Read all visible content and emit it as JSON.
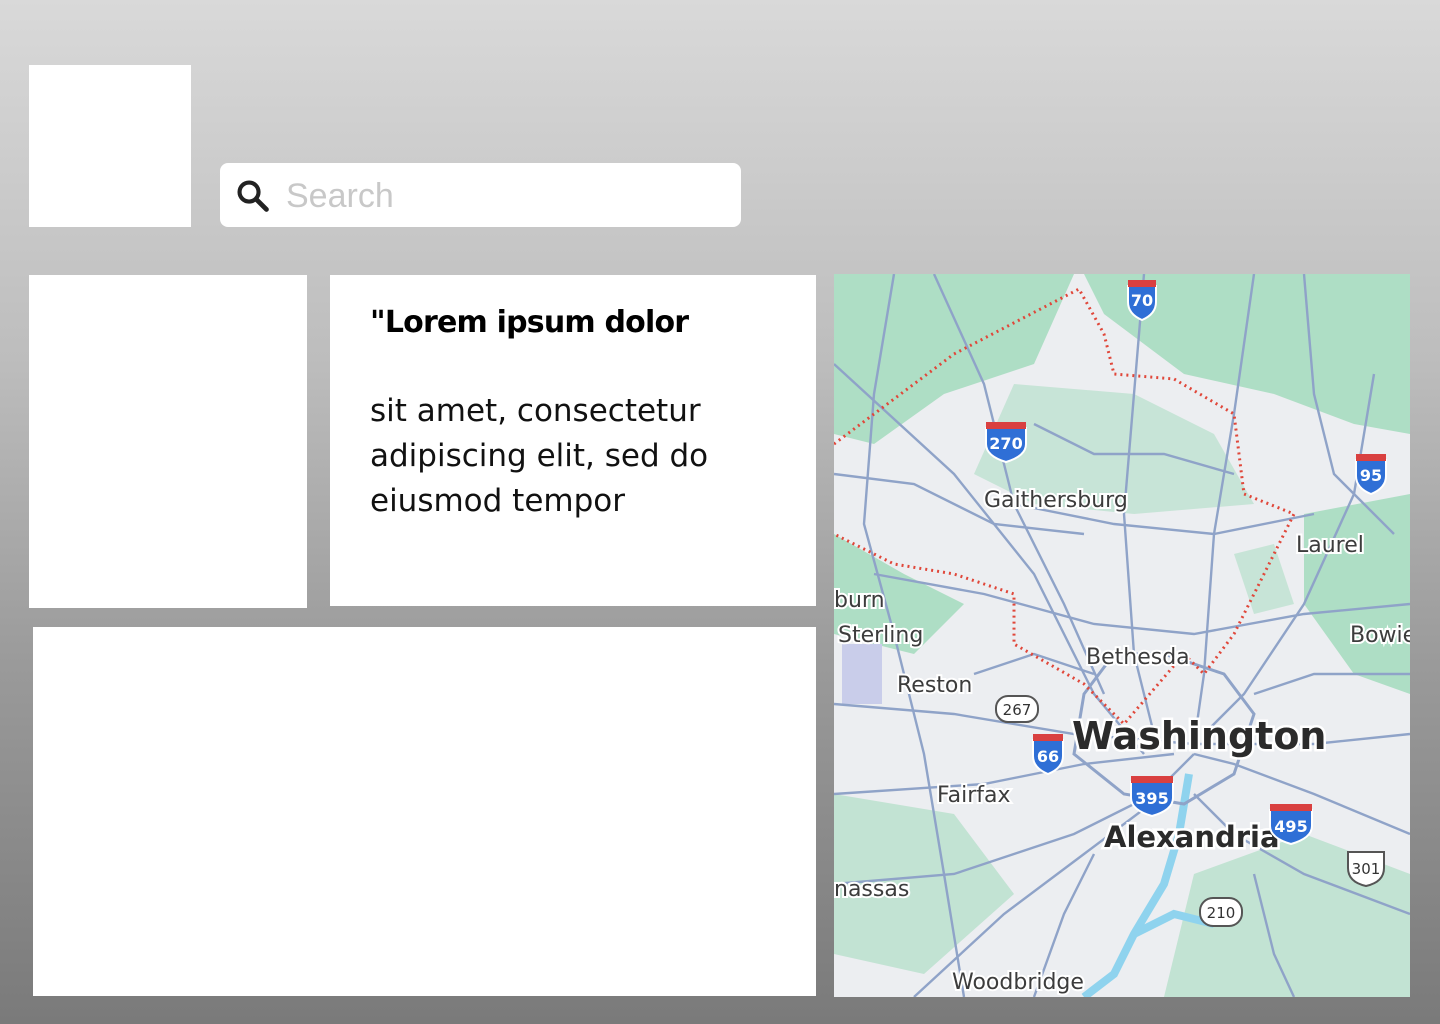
{
  "search": {
    "placeholder": "Search",
    "value": ""
  },
  "card": {
    "title": "\"Lorem ipsum dolor",
    "body": "sit amet, consectetur adipiscing elit, sed do eiusmod tempor"
  },
  "map": {
    "labels": {
      "gaithersburg": "Gaithersburg",
      "laurel": "Laurel",
      "burn": "burn",
      "sterling": "Sterling",
      "bowie": "Bowie",
      "bethesda": "Bethesda",
      "reston": "Reston",
      "washington": "Washington",
      "fairfax": "Fairfax",
      "alexandria": "Alexandria",
      "manassas": "nassas",
      "woodbridge": "Woodbridge"
    },
    "shields": {
      "i70": "70",
      "i270": "270",
      "i95": "95",
      "i66": "66",
      "i395": "395",
      "i495": "495",
      "r267": "267",
      "us301": "301",
      "r210": "210"
    },
    "colors": {
      "park": "#a8dcc0",
      "road": "#8fa3c8",
      "boundary": "#e0473a",
      "water": "#8fd3ee",
      "interstate": "#2f6fd6"
    }
  }
}
